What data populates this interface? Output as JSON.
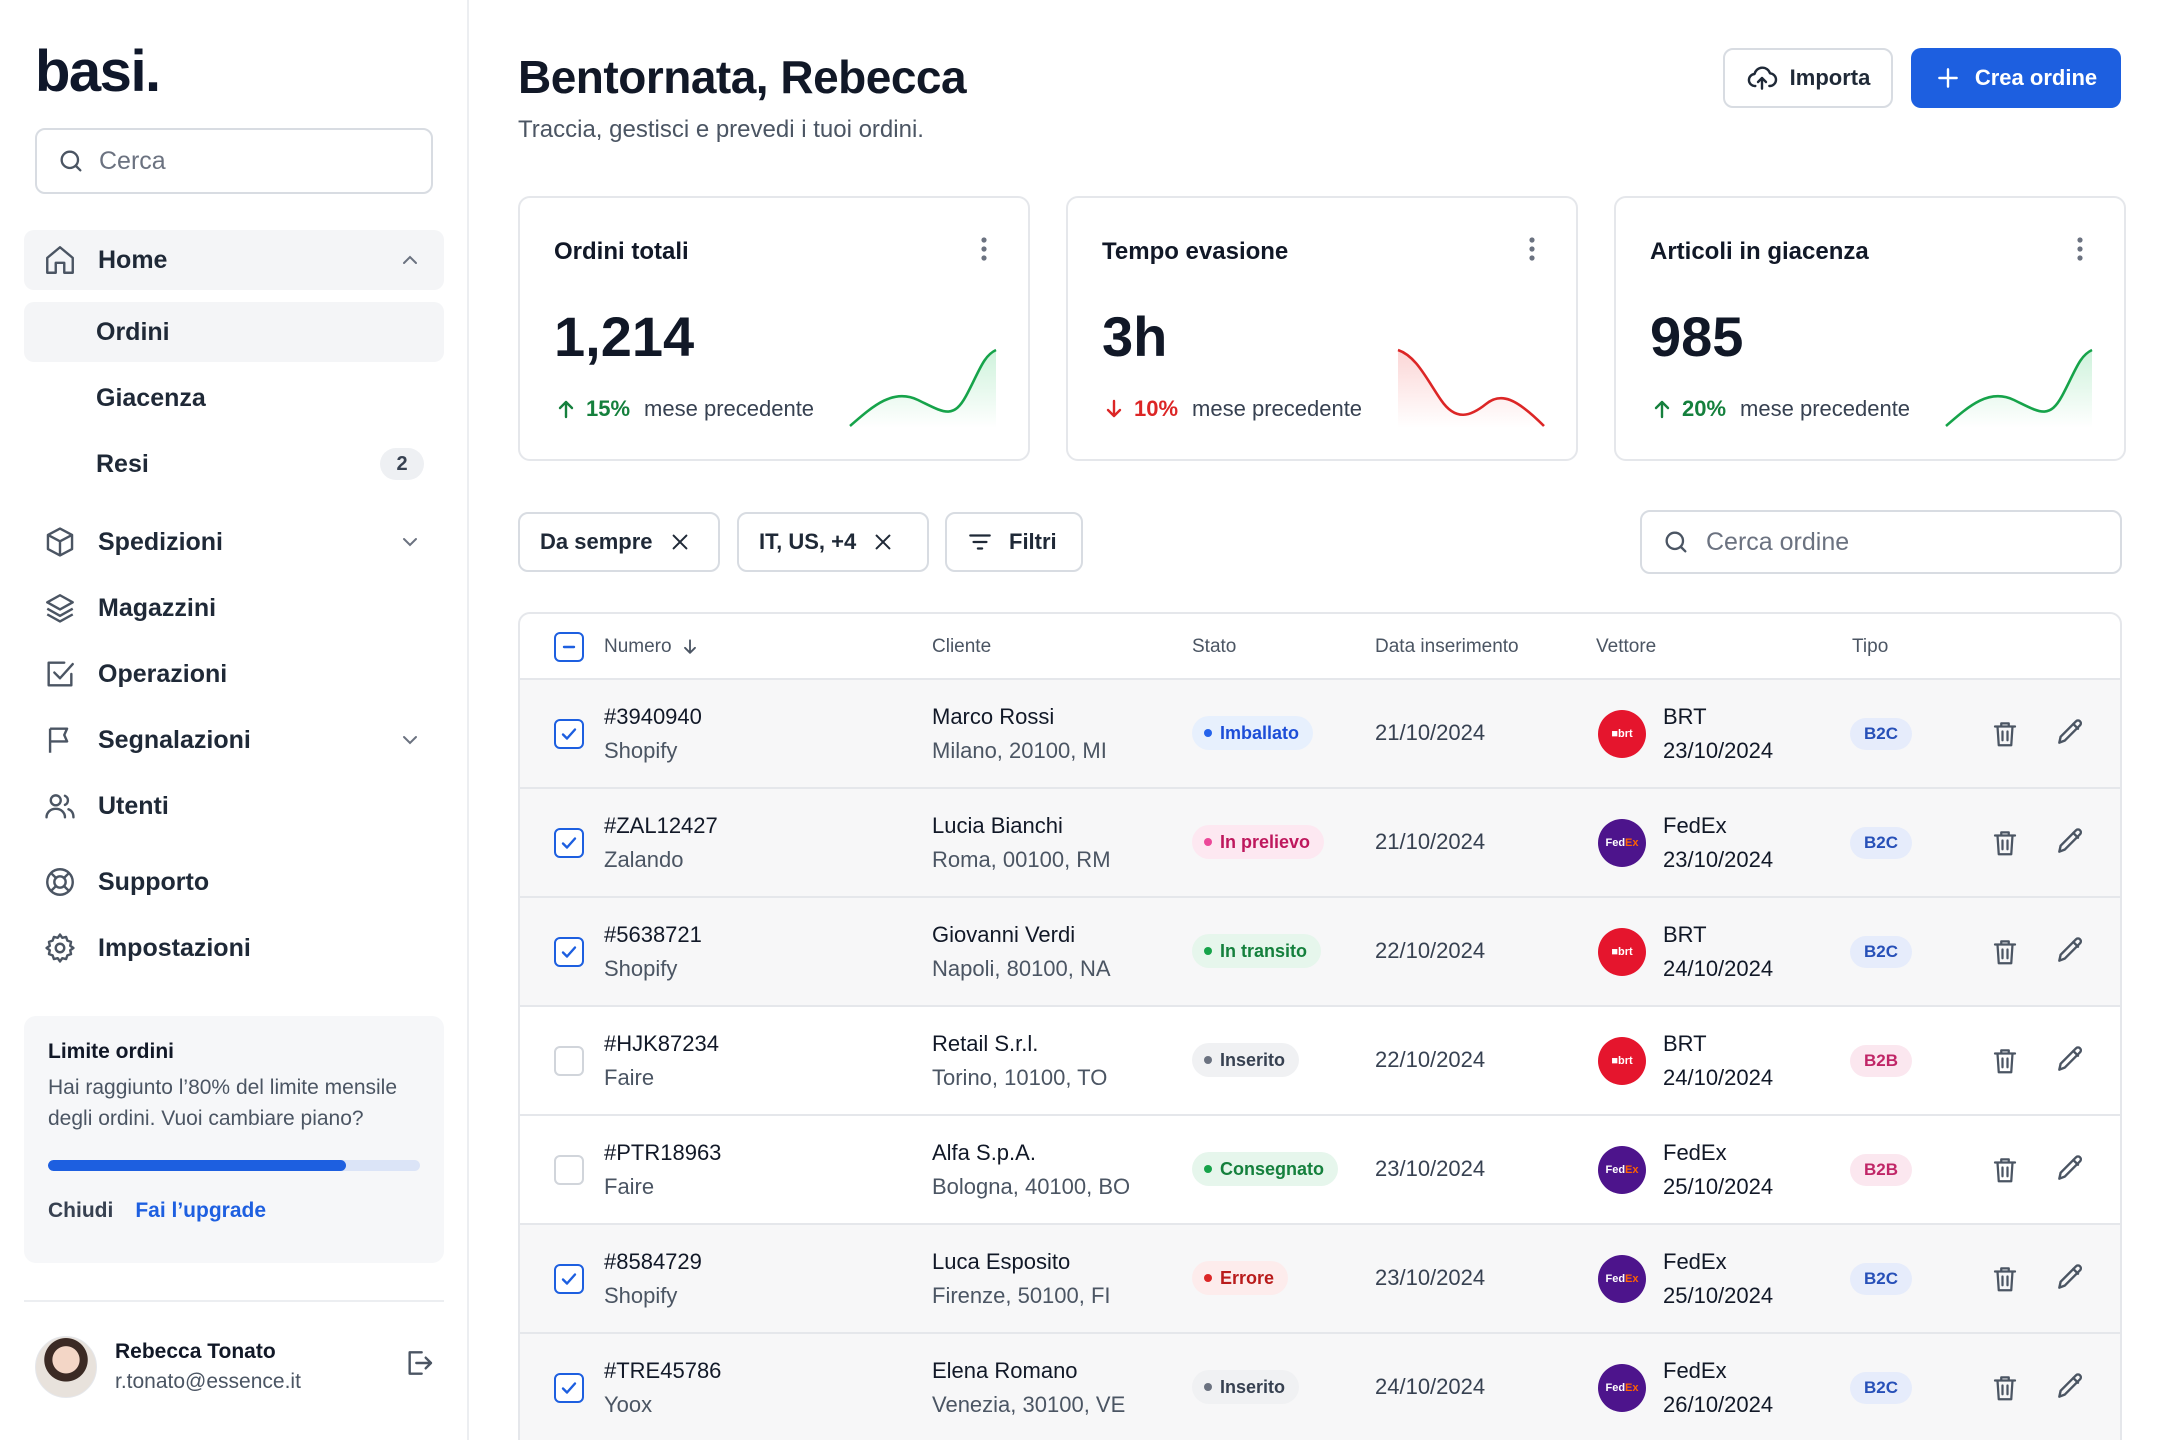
{
  "sidebar": {
    "logo": "basi.",
    "search_placeholder": "Cerca",
    "nav": {
      "home": "Home",
      "ordini": "Ordini",
      "giacenza": "Giacenza",
      "resi": "Resi",
      "resi_count": "2",
      "spedizioni": "Spedizioni",
      "magazzini": "Magazzini",
      "operazioni": "Operazioni",
      "segnalazioni": "Segnalazioni",
      "utenti": "Utenti",
      "supporto": "Supporto",
      "impostazioni": "Impostazioni"
    },
    "limit_card": {
      "title": "Limite ordini",
      "description": "Hai raggiunto l’80% del limite mensile degli ordini. Vuoi cambiare piano?",
      "progress": 0.8,
      "dismiss": "Chiudi",
      "upgrade": "Fai l’upgrade"
    },
    "user": {
      "name": "Rebecca Tonato",
      "email": "r.tonato@essence.it"
    }
  },
  "header": {
    "title": "Bentornata, Rebecca",
    "subtitle": "Traccia, gestisci e prevedi i tuoi ordini.",
    "import_label": "Importa",
    "create_label": "Crea ordine"
  },
  "kpis": [
    {
      "title": "Ordini totali",
      "value": "1,214",
      "change": "15%",
      "direction": "up",
      "caption": "mese precedente"
    },
    {
      "title": "Tempo evasione",
      "value": "3h",
      "change": "10%",
      "direction": "down",
      "caption": "mese precedente"
    },
    {
      "title": "Articoli in giacenza",
      "value": "985",
      "change": "20%",
      "direction": "up",
      "caption": "mese precedente"
    }
  ],
  "filters": {
    "period": "Da sempre",
    "countries": "IT, US, +4",
    "filters_label": "Filtri",
    "search_placeholder": "Cerca ordine"
  },
  "table": {
    "columns": {
      "numero": "Numero",
      "cliente": "Cliente",
      "stato": "Stato",
      "data": "Data inserimento",
      "vettore": "Vettore",
      "tipo": "Tipo"
    },
    "rows": [
      {
        "selected": true,
        "number": "#3940940",
        "channel": "Shopify",
        "customer": "Marco Rossi",
        "address": "Milano, 20100, MI",
        "status": "Imballato",
        "status_kind": "blue",
        "date": "21/10/2024",
        "carrier": "BRT",
        "carrier_kind": "brt",
        "delivery": "23/10/2024",
        "type": "B2C"
      },
      {
        "selected": true,
        "number": "#ZAL12427",
        "channel": "Zalando",
        "customer": "Lucia Bianchi",
        "address": "Roma, 00100, RM",
        "status": "In prelievo",
        "status_kind": "pink",
        "date": "21/10/2024",
        "carrier": "FedEx",
        "carrier_kind": "fedex",
        "delivery": "23/10/2024",
        "type": "B2C"
      },
      {
        "selected": true,
        "number": "#5638721",
        "channel": "Shopify",
        "customer": "Giovanni Verdi",
        "address": "Napoli, 80100, NA",
        "status": "In transito",
        "status_kind": "green",
        "date": "22/10/2024",
        "carrier": "BRT",
        "carrier_kind": "brt",
        "delivery": "24/10/2024",
        "type": "B2C"
      },
      {
        "selected": false,
        "number": "#HJK87234",
        "channel": "Faire",
        "customer": "Retail S.r.l.",
        "address": "Torino, 10100, TO",
        "status": "Inserito",
        "status_kind": "gray",
        "date": "22/10/2024",
        "carrier": "BRT",
        "carrier_kind": "brt",
        "delivery": "24/10/2024",
        "type": "B2B"
      },
      {
        "selected": false,
        "number": "#PTR18963",
        "channel": "Faire",
        "customer": "Alfa S.p.A.",
        "address": "Bologna, 40100, BO",
        "status": "Consegnato",
        "status_kind": "green",
        "date": "23/10/2024",
        "carrier": "FedEx",
        "carrier_kind": "fedex",
        "delivery": "25/10/2024",
        "type": "B2B"
      },
      {
        "selected": true,
        "number": "#8584729",
        "channel": "Shopify",
        "customer": "Luca Esposito",
        "address": "Firenze, 50100, FI",
        "status": "Errore",
        "status_kind": "red",
        "date": "23/10/2024",
        "carrier": "FedEx",
        "carrier_kind": "fedex",
        "delivery": "25/10/2024",
        "type": "B2C"
      },
      {
        "selected": true,
        "number": "#TRE45786",
        "channel": "Yoox",
        "customer": "Elena Romano",
        "address": "Venezia, 30100, VE",
        "status": "Inserito",
        "status_kind": "gray",
        "date": "24/10/2024",
        "carrier": "FedEx",
        "carrier_kind": "fedex",
        "delivery": "26/10/2024",
        "type": "B2C"
      }
    ]
  },
  "colors": {
    "primary": "#1d5fe0",
    "up": "#15803d",
    "down": "#dc2626"
  }
}
